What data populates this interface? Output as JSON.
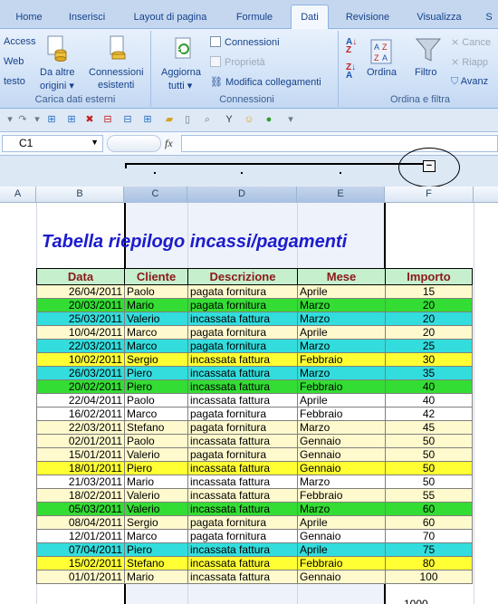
{
  "tabs": [
    "Home",
    "Inserisci",
    "Layout di pagina",
    "Formule",
    "Dati",
    "Revisione",
    "Visualizza",
    "S"
  ],
  "active_tab": "Dati",
  "ribbon": {
    "external": {
      "access": "Access",
      "web": "Web",
      "testo": "testo",
      "altre_origini_1": "Da altre",
      "altre_origini_2": "origini",
      "conn_esistenti_1": "Connessioni",
      "conn_esistenti_2": "esistenti",
      "label": "Carica dati esterni"
    },
    "connections": {
      "aggiorna_1": "Aggiorna",
      "aggiorna_2": "tutti",
      "connessioni": "Connessioni",
      "proprieta": "Proprietà",
      "modifica": "Modifica collegamenti",
      "label": "Connessioni"
    },
    "sort": {
      "ordina": "Ordina",
      "filtro": "Filtro",
      "cancella": "Cance",
      "riapplica": "Riapp",
      "avanzate": "Avanz",
      "label": "Ordina e filtra"
    }
  },
  "namebox": "C1",
  "fx": "fx",
  "outline_button": "−",
  "columns": [
    "A",
    "B",
    "C",
    "D",
    "E",
    "F"
  ],
  "sheet_title": "Tabella riepilogo incassi/pagamenti",
  "headers": [
    "Data",
    "Cliente",
    "Descrizione",
    "Mese",
    "Importo"
  ],
  "rows": [
    [
      "26/04/2011",
      "Paolo",
      "pagata fornitura",
      "Aprile",
      "15"
    ],
    [
      "20/03/2011",
      "Mario",
      "pagata fornitura",
      "Marzo",
      "20"
    ],
    [
      "25/03/2011",
      "Valerio",
      "incassata fattura",
      "Marzo",
      "20"
    ],
    [
      "10/04/2011",
      "Marco",
      "pagata fornitura",
      "Aprile",
      "20"
    ],
    [
      "22/03/2011",
      "Marco",
      "pagata fornitura",
      "Marzo",
      "25"
    ],
    [
      "10/02/2011",
      "Sergio",
      "incassata fattura",
      "Febbraio",
      "30"
    ],
    [
      "26/03/2011",
      "Piero",
      "incassata fattura",
      "Marzo",
      "35"
    ],
    [
      "20/02/2011",
      "Piero",
      "incassata fattura",
      "Febbraio",
      "40"
    ],
    [
      "22/04/2011",
      "Paolo",
      "incassata fattura",
      "Aprile",
      "40"
    ],
    [
      "16/02/2011",
      "Marco",
      "pagata fornitura",
      "Febbraio",
      "42"
    ],
    [
      "22/03/2011",
      "Stefano",
      "pagata fornitura",
      "Marzo",
      "45"
    ],
    [
      "02/01/2011",
      "Paolo",
      "incassata fattura",
      "Gennaio",
      "50"
    ],
    [
      "15/01/2011",
      "Valerio",
      "pagata fornitura",
      "Gennaio",
      "50"
    ],
    [
      "18/01/2011",
      "Piero",
      "incassata fattura",
      "Gennaio",
      "50"
    ],
    [
      "21/03/2011",
      "Mario",
      "incassata fattura",
      "Marzo",
      "50"
    ],
    [
      "18/02/2011",
      "Valerio",
      "incassata fattura",
      "Febbraio",
      "55"
    ],
    [
      "05/03/2011",
      "Valerio",
      "incassata fattura",
      "Marzo",
      "60"
    ],
    [
      "08/04/2011",
      "Sergio",
      "pagata fornitura",
      "Aprile",
      "60"
    ],
    [
      "12/01/2011",
      "Marco",
      "pagata fornitura",
      "Gennaio",
      "70"
    ],
    [
      "07/04/2011",
      "Piero",
      "incassata fattura",
      "Aprile",
      "75"
    ],
    [
      "15/02/2011",
      "Stefano",
      "incassata fattura",
      "Febbraio",
      "80"
    ],
    [
      "01/01/2011",
      "Mario",
      "incassata fattura",
      "Gennaio",
      "100"
    ]
  ],
  "row_colors": [
    "#fffacd",
    "#33dd33",
    "#33dddd",
    "#fffacd",
    "#33dddd",
    "#ffff33",
    "#33dddd",
    "#33dd33",
    "#ffffff",
    "#ffffff",
    "#fffacd",
    "#fffacd",
    "#fffacd",
    "#ffff33",
    "#ffffff",
    "#fffacd",
    "#33dd33",
    "#fffacd",
    "#ffffff",
    "#33dddd",
    "#ffff33",
    "#fffacd"
  ],
  "total_partial": "1000"
}
